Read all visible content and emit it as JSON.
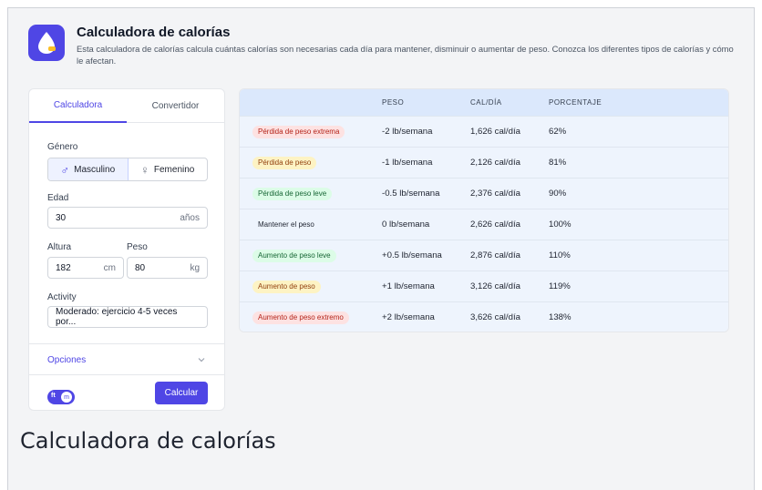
{
  "header": {
    "title": "Calculadora de calorías",
    "description": "Esta calculadora de calorías calcula cuántas calorías son necesarias cada día para mantener, disminuir o aumentar de peso. Conozca los diferentes tipos de calorías y cómo le afectan.",
    "logo_icon": "drop-icon",
    "brand_color": "#4f46e5"
  },
  "tabs": [
    {
      "label": "Calculadora",
      "active": true
    },
    {
      "label": "Convertidor",
      "active": false
    }
  ],
  "form": {
    "gender_label": "Género",
    "gender_options": [
      {
        "label": "Masculino",
        "icon": "male-icon",
        "selected": true
      },
      {
        "label": "Femenino",
        "icon": "female-icon",
        "selected": false
      }
    ],
    "age_label": "Edad",
    "age_value": "30",
    "age_unit": "años",
    "height_label": "Altura",
    "height_value": "182",
    "height_unit": "cm",
    "weight_label": "Peso",
    "weight_value": "80",
    "weight_unit": "kg",
    "activity_label": "Activity",
    "activity_value": "Moderado: ejercicio 4-5 veces por...",
    "options_label": "Opciones",
    "unit_toggle": {
      "left": "ft",
      "right": "m"
    },
    "calculate_label": "Calcular"
  },
  "table": {
    "headers": [
      "",
      "PESO",
      "CAL/DÍA",
      "PORCENTAJE"
    ],
    "rows": [
      {
        "label": "Pérdida de peso extrema",
        "weight": "-2 lb/semana",
        "cal": "1,626 cal/día",
        "pct": "62%",
        "bg": "#fde2e2",
        "fg": "#b42318"
      },
      {
        "label": "Pérdida de peso",
        "weight": "-1 lb/semana",
        "cal": "2,126 cal/día",
        "pct": "81%",
        "bg": "#fdf3c4",
        "fg": "#92400e"
      },
      {
        "label": "Pérdida de peso leve",
        "weight": "-0.5 lb/semana",
        "cal": "2,376 cal/día",
        "pct": "90%",
        "bg": "#dcfce7",
        "fg": "#166534"
      },
      {
        "label": "Mantener el peso",
        "weight": "0 lb/semana",
        "cal": "2,626 cal/día",
        "pct": "100%",
        "bg": "transparent",
        "fg": "#1f2430"
      },
      {
        "label": "Aumento de peso leve",
        "weight": "+0.5 lb/semana",
        "cal": "2,876 cal/día",
        "pct": "110%",
        "bg": "#dcfce7",
        "fg": "#166534"
      },
      {
        "label": "Aumento de peso",
        "weight": "+1 lb/semana",
        "cal": "3,126 cal/día",
        "pct": "119%",
        "bg": "#fdf3c4",
        "fg": "#92400e"
      },
      {
        "label": "Aumento de peso extremo",
        "weight": "+2 lb/semana",
        "cal": "3,626 cal/día",
        "pct": "138%",
        "bg": "#fde2e2",
        "fg": "#b42318"
      }
    ]
  },
  "footer_title": "Calculadora de calorías"
}
